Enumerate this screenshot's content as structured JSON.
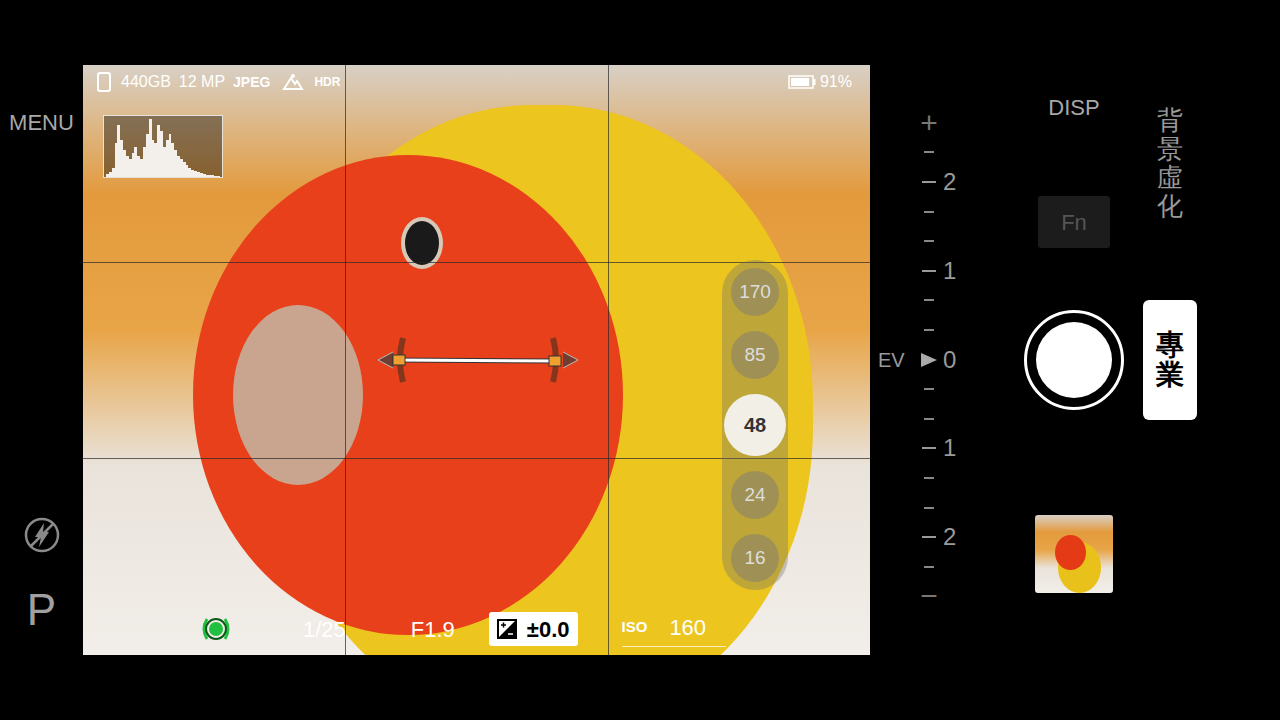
{
  "left": {
    "menu": "MENU",
    "mode": "P",
    "flash_off": true
  },
  "status": {
    "storage": "440GB",
    "megapixels": "12 MP",
    "format": "JPEG",
    "hdr": "HDR",
    "battery": "91%",
    "battery_level": 0.91
  },
  "histogram": {
    "values": [
      0.05,
      0.08,
      0.15,
      0.55,
      0.85,
      0.6,
      0.45,
      0.35,
      0.3,
      0.4,
      0.5,
      0.35,
      0.3,
      0.5,
      0.7,
      0.95,
      0.6,
      0.55,
      0.85,
      0.75,
      0.5,
      0.6,
      0.7,
      0.55,
      0.45,
      0.35,
      0.3,
      0.25,
      0.2,
      0.15,
      0.12,
      0.1,
      0.08,
      0.06,
      0.05,
      0.04,
      0.03,
      0.03,
      0.02,
      0.02
    ]
  },
  "zoom": [
    {
      "label": "170",
      "selected": false
    },
    {
      "label": "85",
      "selected": false
    },
    {
      "label": "48",
      "selected": true
    },
    {
      "label": "24",
      "selected": false
    },
    {
      "label": "16",
      "selected": false
    }
  ],
  "exposure": {
    "shutter": "1/25",
    "aperture": "F1.9",
    "compensation": "±0.0",
    "iso_label": "ISO",
    "iso": "160"
  },
  "ev_scale": {
    "label": "EV",
    "plus": "+",
    "minus": "−",
    "ticks": [
      "2",
      "1",
      "0",
      "1",
      "2"
    ],
    "level": 0.5
  },
  "controls": {
    "disp": "DISP",
    "fn": "Fn",
    "fn_disabled": true,
    "bokeh": "背景虛化",
    "pro": "專業",
    "pro_selected": true
  }
}
